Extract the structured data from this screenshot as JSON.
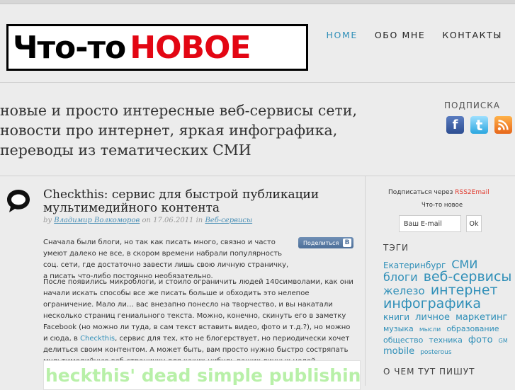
{
  "logo": {
    "part1": "Что-то",
    "part2": "НОВОЕ"
  },
  "nav": [
    {
      "label": "HOME",
      "active": true
    },
    {
      "label": "ОБО МНЕ",
      "active": false
    },
    {
      "label": "КОНТАКТЫ",
      "active": false
    }
  ],
  "tagline": {
    "line1": "новые и просто интересные веб-сервисы сети,",
    "line2": "новости про интернет, яркая инфографика,",
    "line3": "переводы из тематических СМИ"
  },
  "subscribe": {
    "title": "ПОДПИСКА",
    "icons": [
      "facebook-icon",
      "twitter-icon",
      "rss-icon"
    ]
  },
  "post": {
    "title": "Checkthis: сервис для быстрой публикации мультимедийного контента",
    "meta_by": "by",
    "author": "Владимир Волкоморов",
    "meta_on": "on",
    "date": "17.06.2011",
    "meta_in": "in",
    "category": "Веб-сервисы",
    "share_label": "Поделиться",
    "share_vk": "В",
    "p1": "Сначала были блоги, но так как писать много, связно и часто умеют далеко не все, в скором времени набрали популярность соц. сети, где достаточно завести лишь свою личную страничку, а писать что-либо постоянно необязательно.",
    "p2a": "После появились микроблоги, и стоило ограничить людей 140символами, как они начали искать способы все же писать больше и обходить это нелепое ограничение. Мало ли… вас внезапно понесло на творчество, и вы накатали несколько страниц гениального текста. Можно, конечно, скинуть его в заметку Facebook (но можно ли туда, в сам текст вставить видео, фото и т.д.?), но можно и сюда, в",
    "p2link": "Checkthis",
    "p2b": ", сервис для тех, кто не блогерствует, но периодически хочет делиться своим контентом. А может быть, вам просто нужно быстро состряпать мультимедийную веб-страничку для каких-нибудь ваших личных целей.",
    "banner_text": "heckthis' dead simple publishing platfo"
  },
  "sidebar": {
    "subscribe_via": "Подписаться через",
    "rss2email": "RSS2Email",
    "site_name": "Что-то новое",
    "email_placeholder": "Ваш E-mail",
    "ok_label": "Ok",
    "tags_title": "ТЭГИ",
    "tags": [
      {
        "label": "Екатеринбург",
        "size": 12
      },
      {
        "label": "СМИ",
        "size": 16
      },
      {
        "label": "блоги",
        "size": 16
      },
      {
        "label": "веб-сервисы",
        "size": 19
      },
      {
        "label": "железо",
        "size": 15
      },
      {
        "label": "интернет",
        "size": 19
      },
      {
        "label": "инфографика",
        "size": 19
      },
      {
        "label": "книги",
        "size": 12
      },
      {
        "label": "личное",
        "size": 13
      },
      {
        "label": "маркетинг",
        "size": 13
      },
      {
        "label": "музыка",
        "size": 11
      },
      {
        "label": "мысли",
        "size": 9
      },
      {
        "label": "образование",
        "size": 11
      },
      {
        "label": "общество",
        "size": 11
      },
      {
        "label": "техника",
        "size": 11
      },
      {
        "label": "фото",
        "size": 13
      },
      {
        "label": "GM",
        "size": 8
      },
      {
        "label": "mobile",
        "size": 13
      },
      {
        "label": "posterous",
        "size": 9
      }
    ],
    "about_title": "О ЧЕМ ТУТ ПИШУТ"
  },
  "colors": {
    "accent": "#2f8fb8",
    "logo_red": "#e30613",
    "rss_red": "#e03a2e"
  }
}
